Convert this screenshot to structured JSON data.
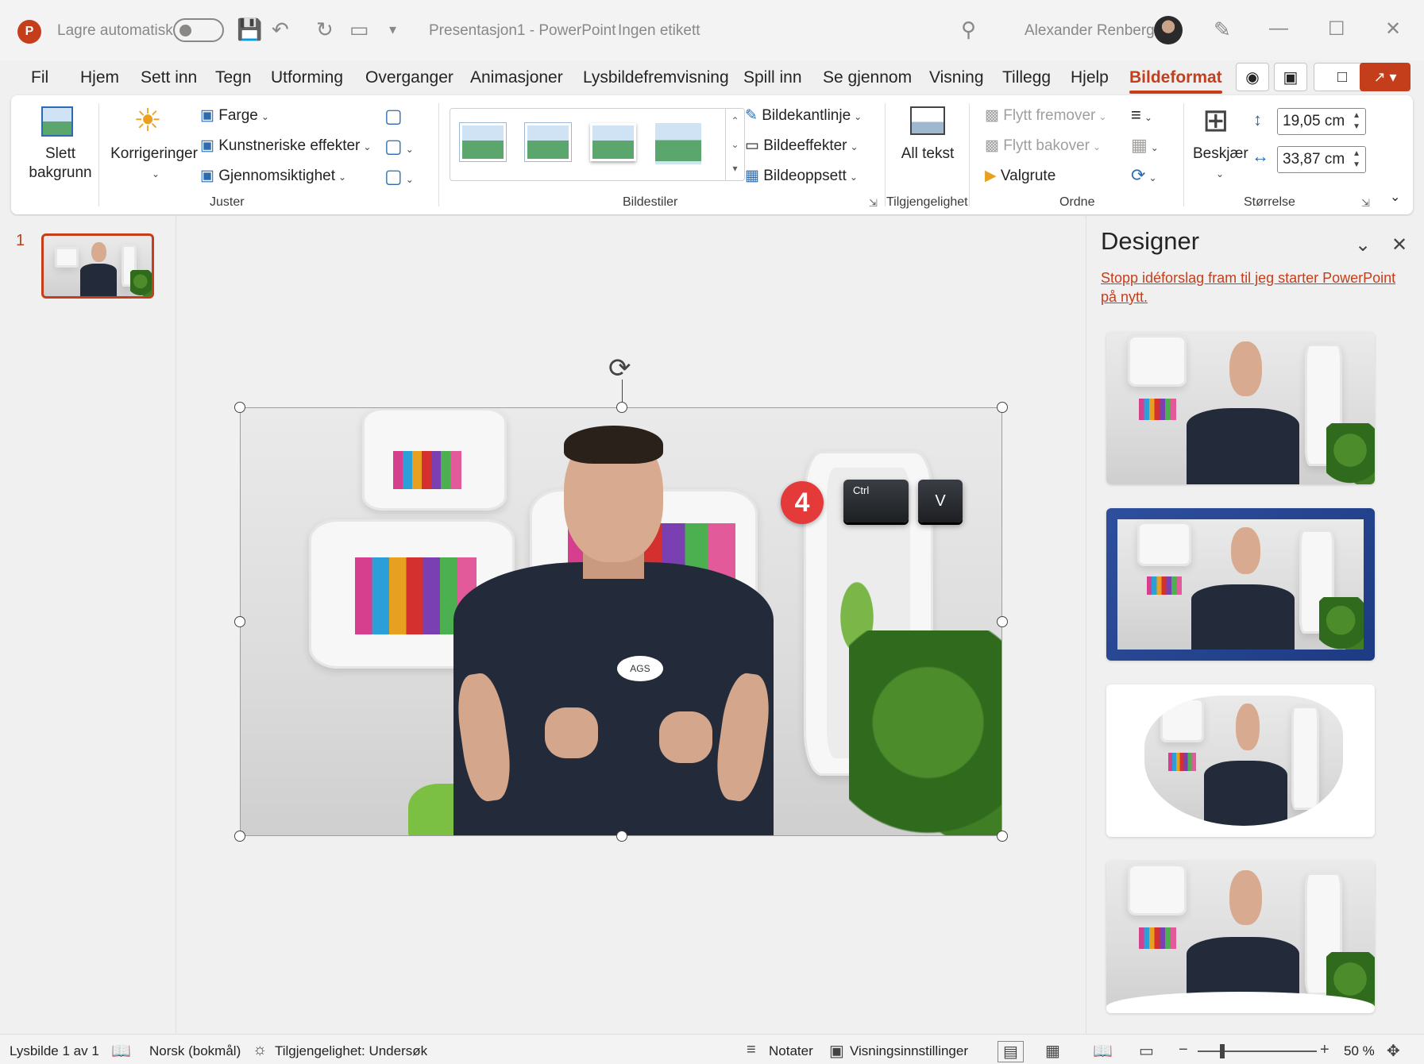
{
  "titlebar": {
    "autosave_label": "Lagre automatisk",
    "document_title": "Presentasjon1  -  PowerPoint",
    "sensitivity_label": "Ingen etikett",
    "user_name": "Alexander Renberg"
  },
  "tabs": [
    {
      "label": "Fil"
    },
    {
      "label": "Hjem"
    },
    {
      "label": "Sett inn"
    },
    {
      "label": "Tegn"
    },
    {
      "label": "Utforming"
    },
    {
      "label": "Overganger"
    },
    {
      "label": "Animasjoner"
    },
    {
      "label": "Lysbildefremvisning"
    },
    {
      "label": "Spill inn"
    },
    {
      "label": "Se gjennom"
    },
    {
      "label": "Visning"
    },
    {
      "label": "Tillegg"
    },
    {
      "label": "Hjelp"
    },
    {
      "label": "Bildeformat",
      "active": true
    }
  ],
  "ribbon": {
    "remove_background": "Slett bakgrunn",
    "corrections": "Korrigeringer",
    "color": "Farge",
    "artistic_effects": "Kunstneriske effekter",
    "transparency": "Gjennomsiktighet",
    "group_adjust": "Juster",
    "group_picture_styles": "Bildestiler",
    "picture_border": "Bildekantlinje",
    "picture_effects": "Bildeeffekter",
    "picture_layout": "Bildeoppsett",
    "alt_text": "All tekst",
    "group_accessibility": "Tilgjengelighet",
    "bring_forward": "Flytt fremover",
    "send_backward": "Flytt bakover",
    "selection_pane": "Valgrute",
    "group_arrange": "Ordne",
    "crop": "Beskjær",
    "height": "19,05 cm",
    "width": "33,87 cm",
    "group_size": "Størrelse"
  },
  "slides_pane": {
    "slide_number": "1"
  },
  "canvas": {
    "step_badge": "4",
    "key_ctrl": "Ctrl",
    "key_v": "V",
    "shirt_logo": "AGS"
  },
  "designer": {
    "title": "Designer",
    "stop_link": "Stopp idéforslag fram til jeg starter PowerPoint på nytt."
  },
  "statusbar": {
    "slide_info": "Lysbilde 1 av 1",
    "language": "Norsk (bokmål)",
    "accessibility": "Tilgjengelighet: Undersøk",
    "notes": "Notater",
    "view_settings": "Visningsinnstillinger",
    "zoom": "50 %"
  },
  "colors": {
    "accent": "#c43e1c",
    "badge": "#e53a3a",
    "designer_selected": "#2e4f9c"
  }
}
